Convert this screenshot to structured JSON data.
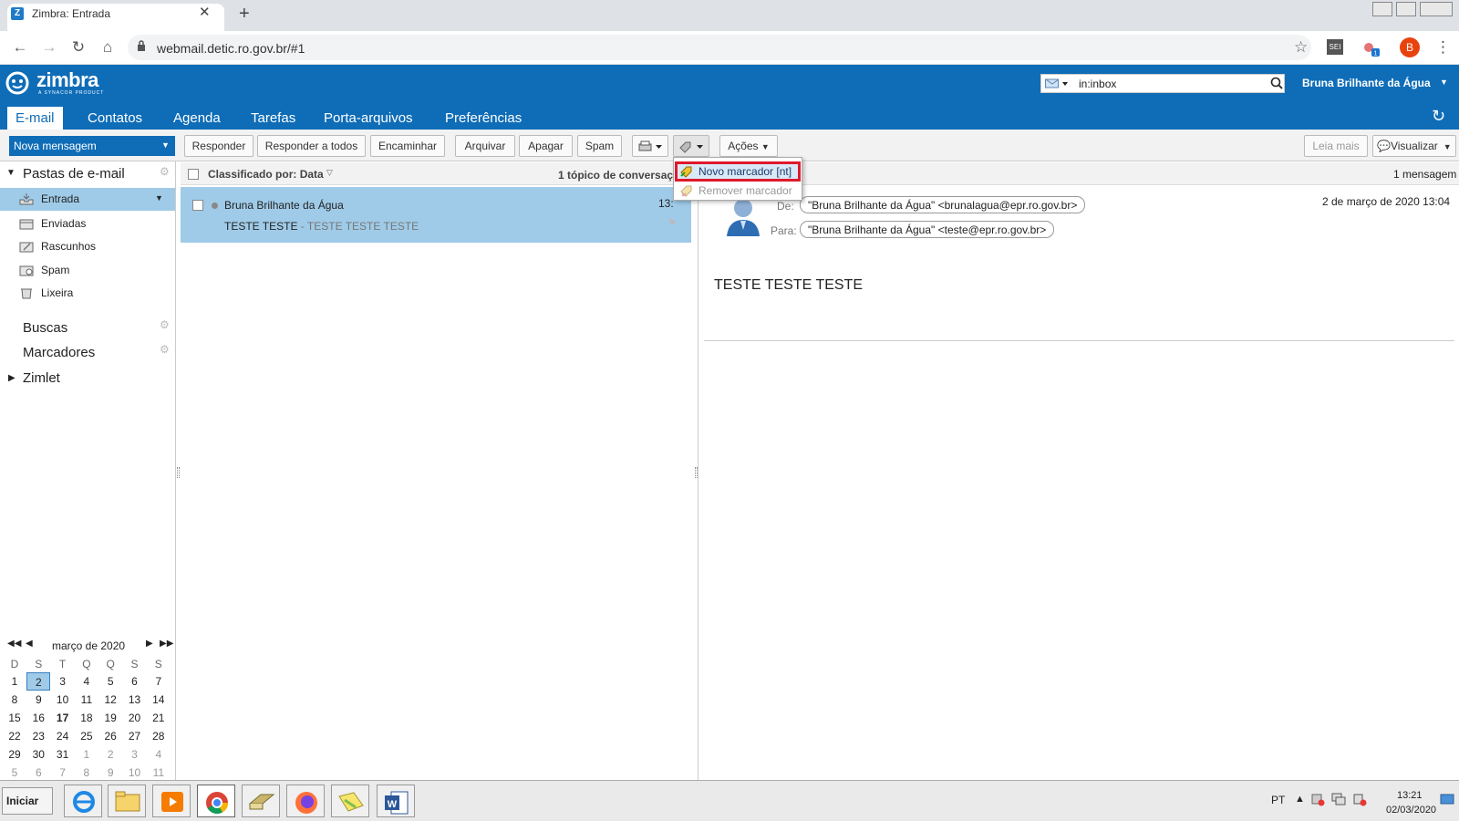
{
  "browser": {
    "tab_title": "Zimbra: Entrada",
    "tab_favicon": "Z",
    "url": "webmail.detic.ro.gov.br/#1",
    "profile_initial": "B",
    "extension_label": "SEI"
  },
  "zimbra": {
    "logo": "zimbra",
    "logo_sub": "A SYNACOR PRODUCT",
    "search_value": "in:inbox",
    "user_name": "Bruna Brilhante da Água",
    "app_tabs": [
      "E-mail",
      "Contatos",
      "Agenda",
      "Tarefas",
      "Porta-arquivos",
      "Preferências"
    ],
    "active_tab": "E-mail"
  },
  "actions": {
    "new_message": "Nova mensagem",
    "reply": "Responder",
    "reply_all": "Responder a todos",
    "forward": "Encaminhar",
    "archive": "Arquivar",
    "delete": "Apagar",
    "spam": "Spam",
    "more_actions": "Ações",
    "read_more": "Leia mais",
    "view": "Visualizar"
  },
  "sidebar": {
    "mail_folders_title": "Pastas de e-mail",
    "folders": [
      {
        "label": "Entrada",
        "icon": "inbox-icon"
      },
      {
        "label": "Enviadas",
        "icon": "sent-icon"
      },
      {
        "label": "Rascunhos",
        "icon": "drafts-icon"
      },
      {
        "label": "Spam",
        "icon": "spam-icon"
      },
      {
        "label": "Lixeira",
        "icon": "trash-icon"
      }
    ],
    "searches": "Buscas",
    "tags": "Marcadores",
    "zimlet": "Zimlet"
  },
  "calendar": {
    "title": "março de 2020",
    "weekdays": [
      "D",
      "S",
      "T",
      "Q",
      "Q",
      "S",
      "S"
    ],
    "weeks": [
      [
        "1",
        "2",
        "3",
        "4",
        "5",
        "6",
        "7"
      ],
      [
        "8",
        "9",
        "10",
        "11",
        "12",
        "13",
        "14"
      ],
      [
        "15",
        "16",
        "17",
        "18",
        "19",
        "20",
        "21"
      ],
      [
        "22",
        "23",
        "24",
        "25",
        "26",
        "27",
        "28"
      ],
      [
        "29",
        "30",
        "31",
        "1",
        "2",
        "3",
        "4"
      ],
      [
        "5",
        "6",
        "7",
        "8",
        "9",
        "10",
        "11"
      ]
    ],
    "selected_day": "2",
    "bold_day": "17"
  },
  "message_list": {
    "sort_label": "Classificado por: Data",
    "conversation_count": "1 tópico de conversaç",
    "rows": [
      {
        "from": "Bruna Brilhante da Água",
        "subject": "TESTE TESTE",
        "fragment": " - TESTE TESTE TESTE",
        "time": "13:"
      }
    ]
  },
  "reading_pane": {
    "message_count": "1 mensagem",
    "from_label": "De:",
    "from": "\"Bruna Brilhante da Água\" <brunalagua@epr.ro.gov.br>",
    "to_label": "Para:",
    "to": "\"Bruna Brilhante da Água\" <teste@epr.ro.gov.br>",
    "date": "2 de março de 2020 13:04",
    "body": "TESTE TESTE TESTE"
  },
  "tag_menu": {
    "new_tag": "Novo marcador [nt]",
    "remove_tag": "Remover marcador"
  },
  "taskbar": {
    "start": "Iniciar",
    "lang": "PT",
    "time": "13:21",
    "date": "02/03/2020"
  },
  "colors": {
    "header_blue": "#0f6db8",
    "selection_blue": "#9fcbe8",
    "highlight_red": "#e0192c"
  }
}
